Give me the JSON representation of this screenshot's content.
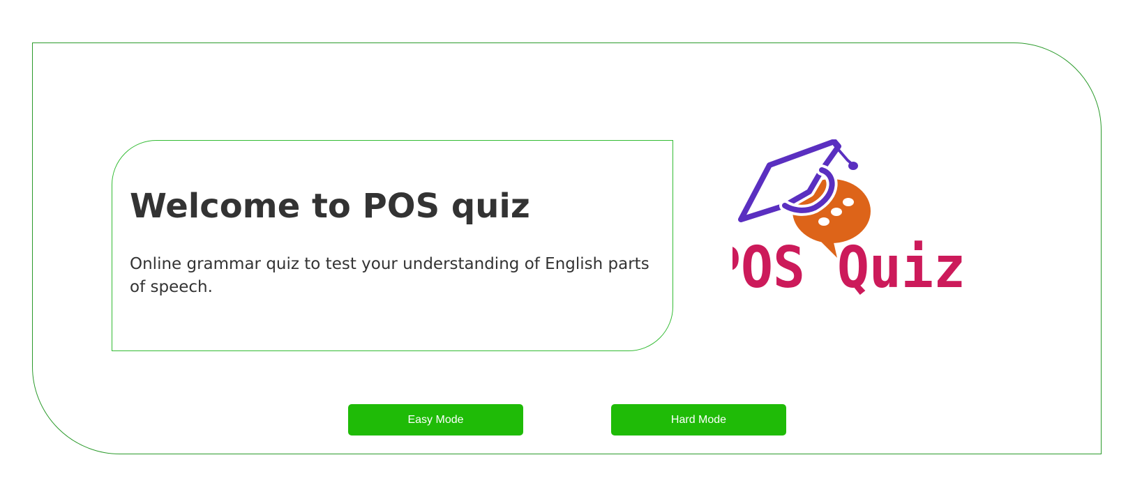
{
  "welcome": {
    "title": "Welcome to POS quiz",
    "description": "Online grammar quiz to test your understanding of English parts of speech."
  },
  "logo": {
    "text": "POS Quiz",
    "icons": [
      "graduation-cap-icon",
      "speech-bubble-icon"
    ],
    "colors": {
      "text": "#cc1a5a",
      "cap": "#5a2fc0",
      "bubble": "#dd6419"
    }
  },
  "buttons": {
    "easy_label": "Easy Mode",
    "hard_label": "Hard Mode",
    "color": "#1fbb07"
  },
  "colors": {
    "frame_border": "#2a9a2a",
    "card_border": "#33bb33"
  }
}
